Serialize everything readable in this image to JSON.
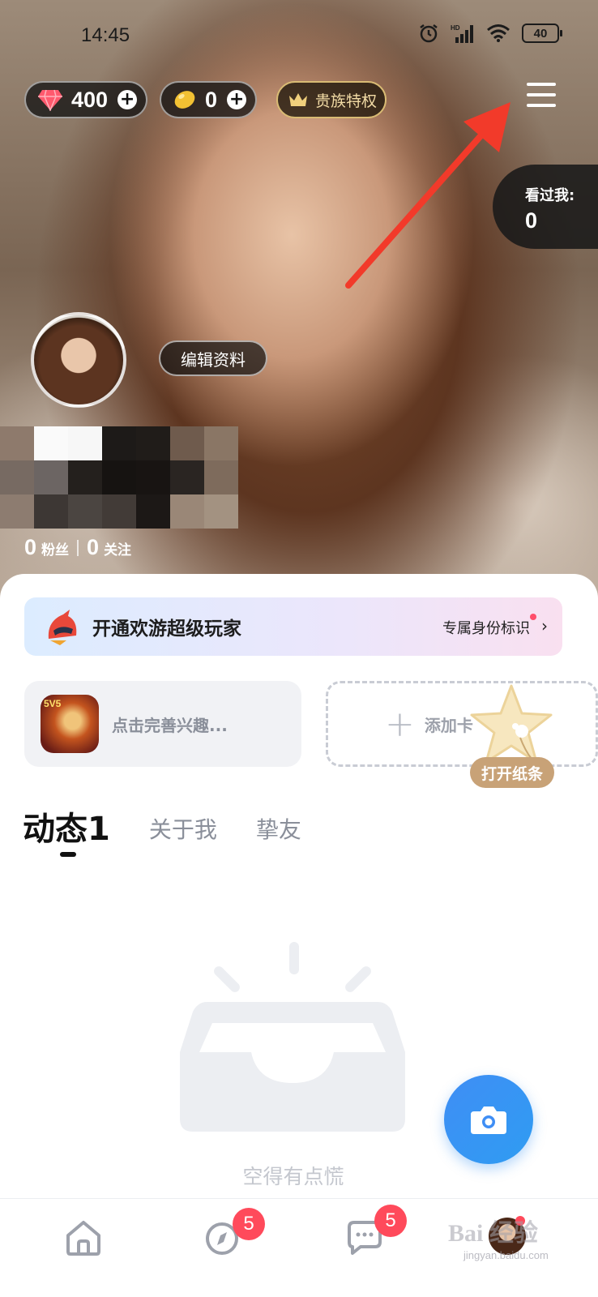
{
  "status_bar": {
    "time": "14:45",
    "battery": "40",
    "network": "HD"
  },
  "wallet": {
    "gems": "400",
    "beans": "0",
    "noble_label": "贵族特权"
  },
  "visitors": {
    "label": "看过我:",
    "count": "0"
  },
  "profile": {
    "edit_label": "编辑资料",
    "fans_count": "0",
    "fans_label": "粉丝",
    "follow_count": "0",
    "follow_label": "关注"
  },
  "vip_banner": {
    "title": "开通欢游超级玩家",
    "subtitle": "专属身份标识"
  },
  "interest_card": {
    "text": "点击完善兴趣...",
    "game_tag": "5V5"
  },
  "add_card": {
    "text": "添加卡"
  },
  "note_button": {
    "label": "打开纸条"
  },
  "tabs": [
    {
      "label": "动态1",
      "active": true
    },
    {
      "label": "关于我",
      "active": false
    },
    {
      "label": "挚友",
      "active": false
    }
  ],
  "empty_state": {
    "text": "空得有点慌"
  },
  "bottom_nav": {
    "items": [
      {
        "name": "home",
        "badge": ""
      },
      {
        "name": "discover",
        "badge": "5"
      },
      {
        "name": "messages",
        "badge": "5"
      },
      {
        "name": "me",
        "badge": ""
      }
    ]
  },
  "watermark": {
    "text": "Bai 经验",
    "sub": "jingyan.baidu.com"
  },
  "colors": {
    "accent_blue": "#3f8ef5",
    "badge_red": "#ff4a5b",
    "noble_gold": "#d9bb74",
    "arrow_red": "#f23a2a"
  }
}
